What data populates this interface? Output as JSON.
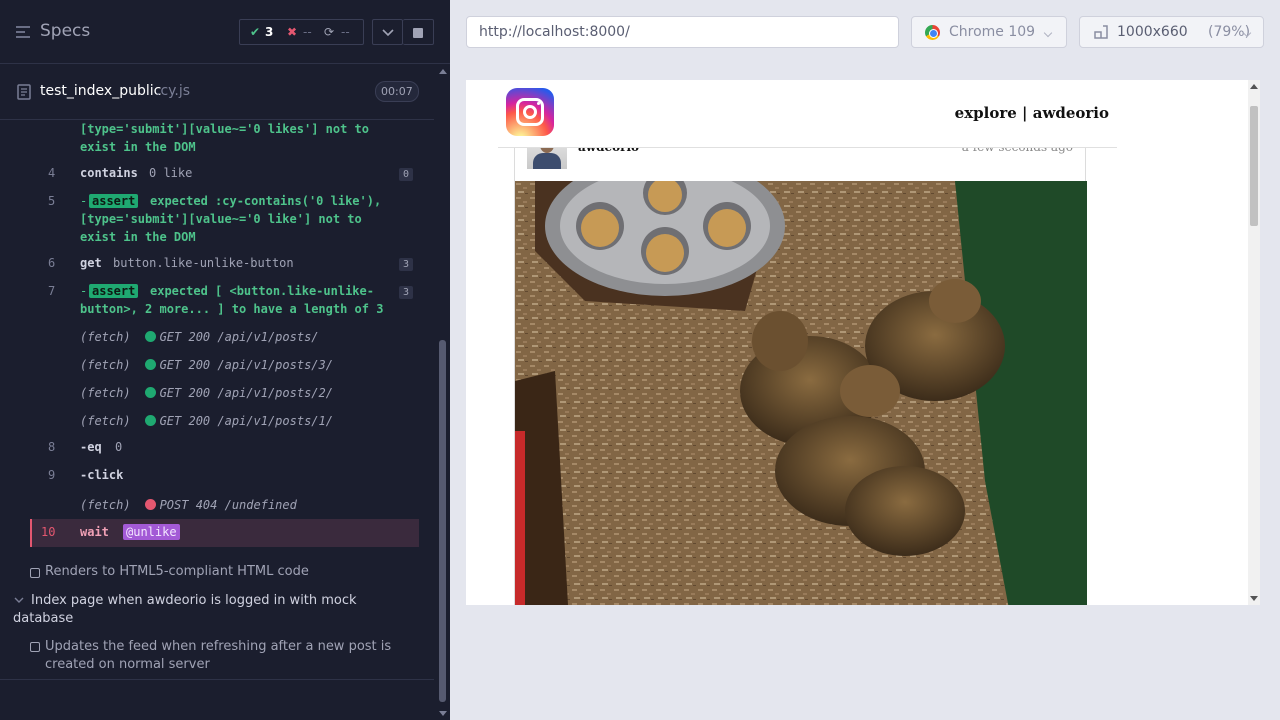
{
  "colors": {
    "reporter_bg": "#1b1e2e",
    "pass": "#4ec38b",
    "fail": "#e45770",
    "alias": "#a35ad6",
    "aut_bg": "#e4e6ee"
  },
  "header": {
    "specs_title": "Specs",
    "stats": {
      "passed": "3",
      "failed": "--",
      "pending": "--"
    }
  },
  "file": {
    "name": "test_index_public",
    "ext": ".cy.js",
    "duration": "00:07"
  },
  "commands": {
    "c3_line1": "[type='submit'][value~='0 likes'] not to",
    "c3_line2": "exist in the DOM",
    "c4": {
      "num": "4",
      "name": "contains",
      "msg": "0 like",
      "badge": "0"
    },
    "c5": {
      "num": "5",
      "tag": "assert",
      "line1": "expected :cy-contains('0 like'),",
      "line2": "[type='submit'][value~='0 like'] not to",
      "line3": "exist in the DOM"
    },
    "c6": {
      "num": "6",
      "name": "get",
      "msg": "button.like-unlike-button",
      "badge": "3"
    },
    "c7": {
      "num": "7",
      "tag": "assert",
      "line1": "expected [ <button.like-unlike-",
      "line2": "button>, 2 more... ] to have a length of 3",
      "badge": "3"
    },
    "fetch": [
      {
        "prefix": "(fetch)",
        "text": "GET 200 /api/v1/posts/"
      },
      {
        "prefix": "(fetch)",
        "text": "GET 200 /api/v1/posts/3/"
      },
      {
        "prefix": "(fetch)",
        "text": "GET 200 /api/v1/posts/2/"
      },
      {
        "prefix": "(fetch)",
        "text": "GET 200 /api/v1/posts/1/"
      }
    ],
    "c8": {
      "num": "8",
      "name": "-eq",
      "msg": "0"
    },
    "c9": {
      "num": "9",
      "name": "-click"
    },
    "fetch_err": {
      "prefix": "(fetch)",
      "text": "POST 404 /undefined"
    },
    "c10": {
      "num": "10",
      "name": "wait",
      "alias": "@unlike"
    }
  },
  "tests": {
    "renders": "Renders to HTML5-compliant HTML code",
    "suite": "Index page when awdeorio is logged in with mock database",
    "updates": "Updates the feed when refreshing after a new post is created on normal server"
  },
  "browser": {
    "url": "http://localhost:8000/",
    "name": "Chrome 109",
    "viewport": "1000x660",
    "scale": "(79%)"
  },
  "aut": {
    "nav": {
      "explore": "explore",
      "sep": "|",
      "user": "awdeorio"
    },
    "post": {
      "owner": "awdeorio",
      "time": "a few seconds ago"
    }
  }
}
